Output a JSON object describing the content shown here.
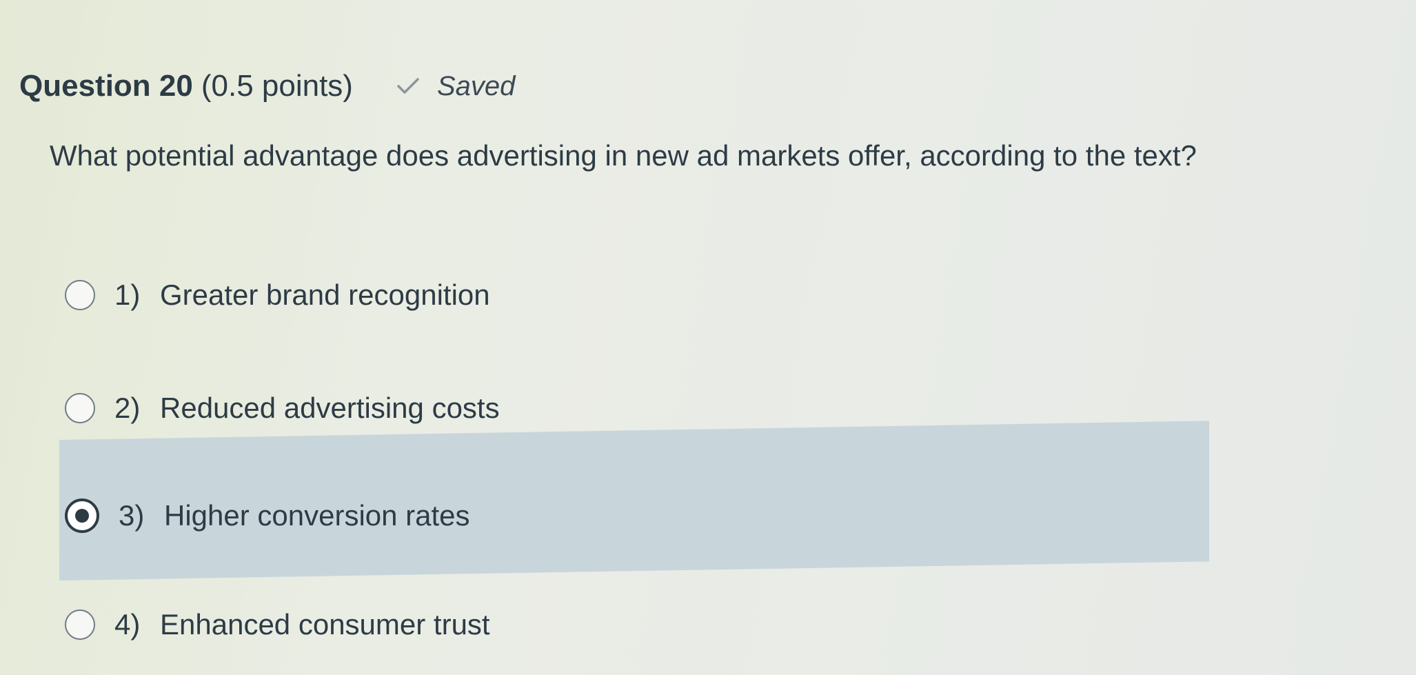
{
  "question": {
    "title": "Question 20",
    "points": "(0.5 points)",
    "status": "Saved",
    "status_icon": "checkmark-icon",
    "text": "What potential advantage does advertising in new ad markets offer, according to the text?"
  },
  "options": [
    {
      "number": "1)",
      "label": "Greater brand recognition",
      "selected": false
    },
    {
      "number": "2)",
      "label": "Reduced advertising costs",
      "selected": false
    },
    {
      "number": "3)",
      "label": "Higher conversion rates",
      "selected": true
    },
    {
      "number": "4)",
      "label": "Enhanced consumer trust",
      "selected": false
    }
  ],
  "colors": {
    "text": "#2d3b45",
    "selected_background": "#c8d6db",
    "saved_check": "#8a959c"
  }
}
